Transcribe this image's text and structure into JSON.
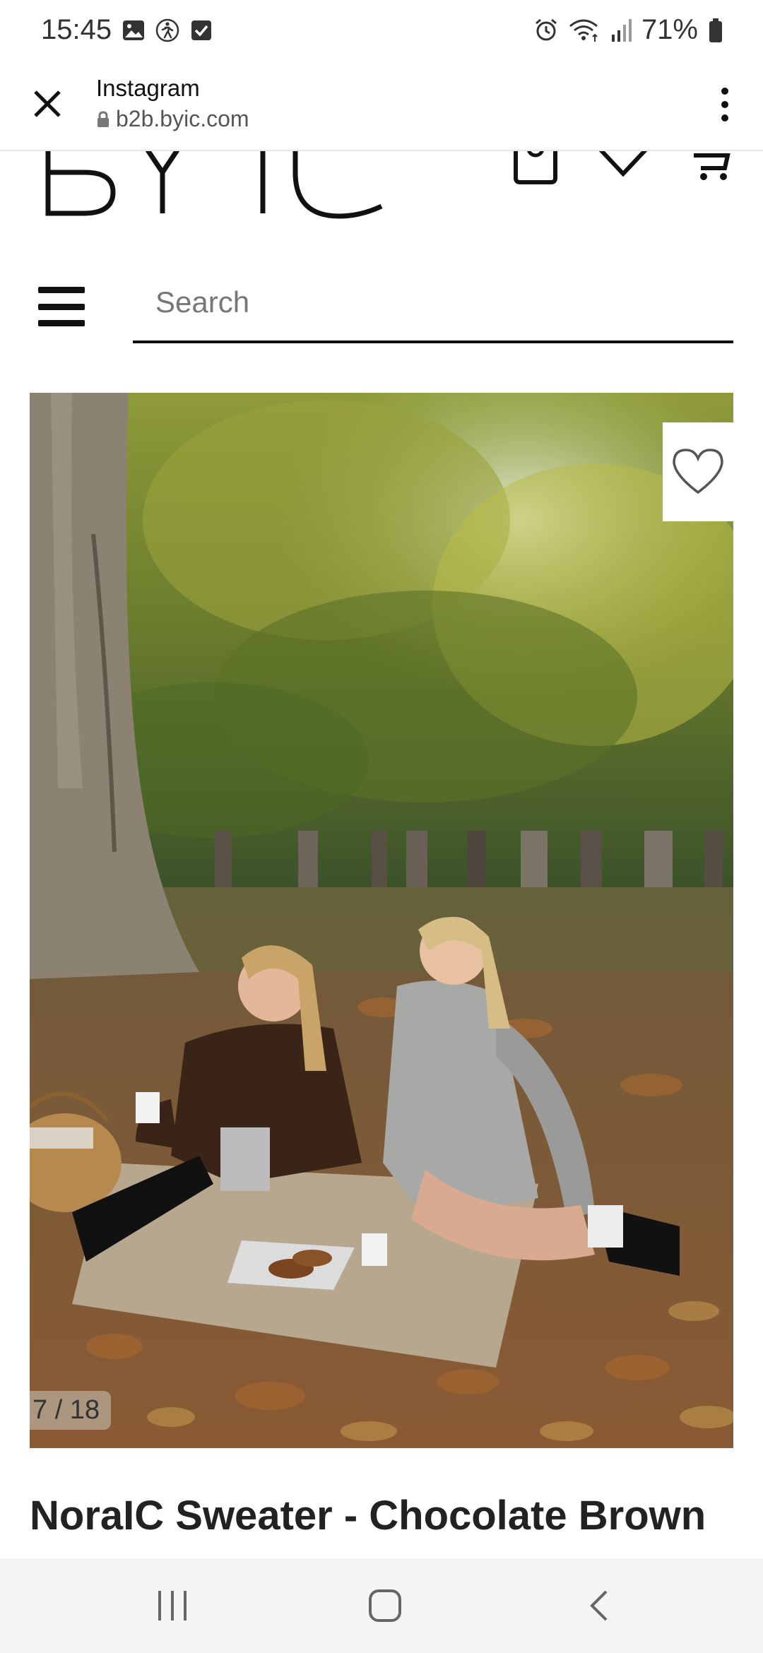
{
  "status_bar": {
    "time": "15:45",
    "battery": "71%",
    "left_icons": [
      "gallery-icon",
      "accessibility-icon",
      "check-box-icon"
    ],
    "right_icons": [
      "alarm-icon",
      "wifi-icon",
      "signal-icon",
      "battery-icon"
    ]
  },
  "browser": {
    "title": "Instagram",
    "url": "b2b.byic.com",
    "close_icon": "close-icon",
    "menu_icon": "more-vert-icon"
  },
  "site": {
    "logo_text": "BYIC",
    "search": {
      "placeholder": "Search",
      "value": ""
    },
    "header_icons": [
      "account-icon",
      "wishlist-icon",
      "cart-icon"
    ]
  },
  "product": {
    "image_counter": "7 / 18",
    "title": "NoraIC Sweater - Chocolate Brown",
    "wishlist_icon": "heart-icon"
  },
  "nav_bar": {
    "buttons": [
      "recents-icon",
      "home-icon",
      "back-icon"
    ]
  },
  "colors": {
    "text": "#222222",
    "nav_bg": "#f4f4f4",
    "sweater_brown": "#3a2418",
    "grey_cardigan": "#a8a8a6"
  }
}
